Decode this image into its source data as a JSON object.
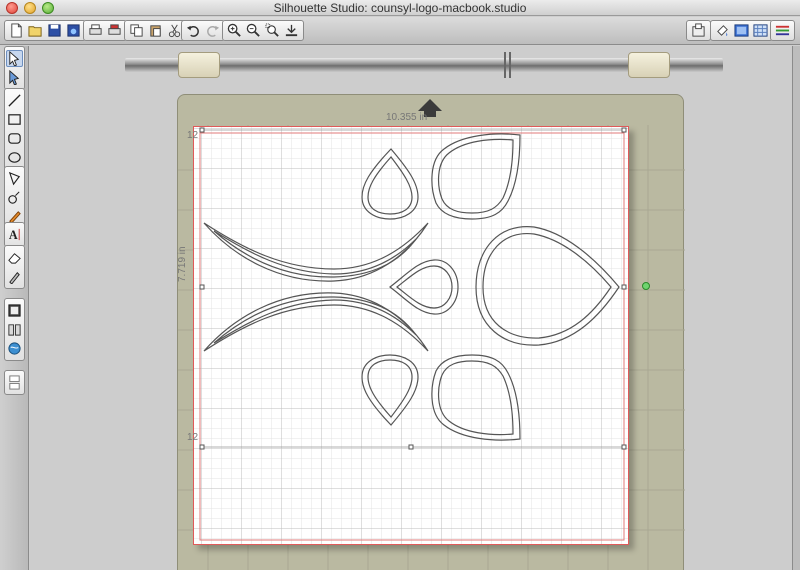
{
  "window": {
    "title": "Silhouette Studio: counsyl-logo-macbook.studio"
  },
  "toolbar": {
    "groups": [
      {
        "name": "file",
        "icons": [
          "new-file-icon",
          "open-folder-icon",
          "save-icon",
          "save-to-library-icon"
        ]
      },
      {
        "name": "print",
        "icons": [
          "print-icon",
          "print-cut-icon"
        ]
      },
      {
        "name": "clipboard",
        "icons": [
          "copy-icon",
          "paste-icon",
          "cut-icon"
        ]
      },
      {
        "name": "history",
        "icons": [
          "undo-icon",
          "redo-icon"
        ]
      },
      {
        "name": "zoom",
        "icons": [
          "zoom-in-icon",
          "zoom-out-icon",
          "zoom-select-icon",
          "zoom-fit-icon"
        ]
      }
    ],
    "right_icons": [
      "cut-settings-icon",
      "fill-icon",
      "page-view-icon",
      "grid-view-icon",
      "line-style-icon"
    ]
  },
  "tools": {
    "groups": [
      [
        "select-tool-icon",
        "point-edit-icon"
      ],
      [
        "line-tool-icon",
        "rectangle-tool-icon",
        "rounded-rect-icon",
        "ellipse-tool-icon"
      ],
      [
        "polygon-tool-icon",
        "curve-tool-icon",
        "freehand-tool-icon"
      ],
      [
        "text-tool-icon"
      ],
      [
        "eraser-tool-icon",
        "knife-tool-icon"
      ],
      [
        "cut-mode-icon",
        "library-icon",
        "online-store-icon"
      ],
      [
        "panel-toggle-icon"
      ]
    ]
  },
  "canvas": {
    "width_label": "10.355 in",
    "height_label": "7.719 in",
    "ruler_marks": [
      "12",
      "12"
    ],
    "colors": {
      "mat": "#bab9a1",
      "paper_border": "#e05a5a",
      "grid": "#c9c9c9",
      "shape_stroke": "#555555",
      "registration_dot": "#6fd46f"
    }
  }
}
